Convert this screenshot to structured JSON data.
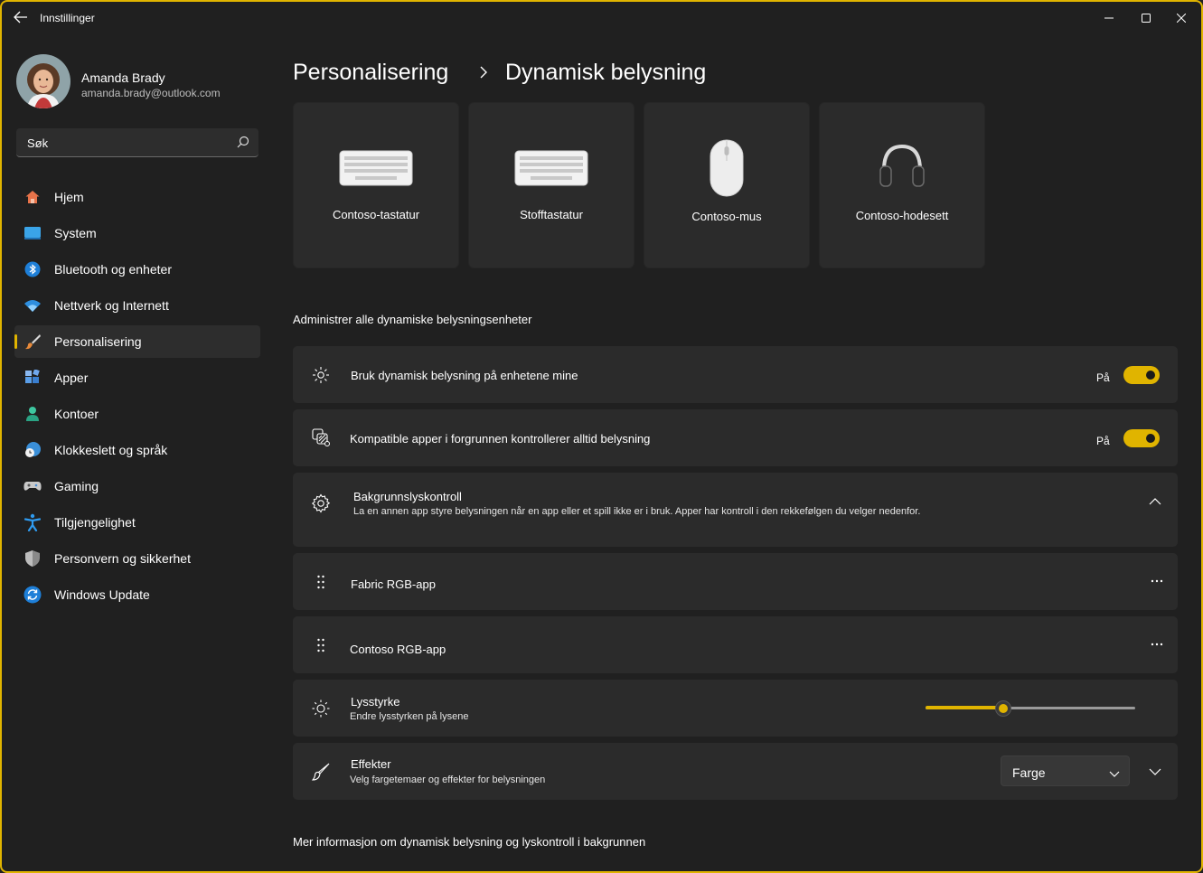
{
  "window": {
    "title": "Innstillinger"
  },
  "profile": {
    "name": "Amanda Brady",
    "email": "amanda.brady@outlook.com"
  },
  "search": {
    "placeholder": "Søk"
  },
  "nav": {
    "items": [
      {
        "label": "Hjem",
        "icon": "home-icon"
      },
      {
        "label": "System",
        "icon": "system-icon"
      },
      {
        "label": "Bluetooth og enheter",
        "icon": "bluetooth-icon"
      },
      {
        "label": "Nettverk og Internett",
        "icon": "wifi-icon"
      },
      {
        "label": "Personalisering",
        "icon": "brush-icon",
        "active": true
      },
      {
        "label": "Apper",
        "icon": "apps-icon"
      },
      {
        "label": "Kontoer",
        "icon": "account-icon"
      },
      {
        "label": "Klokkeslett og språk",
        "icon": "clock-globe-icon"
      },
      {
        "label": "Gaming",
        "icon": "gamepad-icon"
      },
      {
        "label": "Tilgjengelighet",
        "icon": "accessibility-icon"
      },
      {
        "label": "Personvern og sikkerhet",
        "icon": "shield-icon"
      },
      {
        "label": "Windows Update",
        "icon": "update-icon"
      }
    ]
  },
  "breadcrumb": {
    "parent": "Personalisering",
    "current": "Dynamisk belysning"
  },
  "devices": [
    {
      "label": "Contoso-tastatur",
      "icon": "keyboard-icon"
    },
    {
      "label": "Stofftastatur",
      "icon": "keyboard-icon"
    },
    {
      "label": "Contoso-mus",
      "icon": "mouse-icon"
    },
    {
      "label": "Contoso-hodesett",
      "icon": "headset-icon"
    }
  ],
  "manage_title": "Administrer alle dynamiske belysningsenheter",
  "settings": {
    "use_lighting": {
      "title": "Bruk dynamisk belysning på enhetene mine",
      "state": "På",
      "on": true
    },
    "compatible_apps": {
      "title": "Kompatible apper i forgrunnen kontrollerer alltid belysning",
      "state": "På",
      "on": true
    },
    "background_control": {
      "title": "Bakgrunnslyskontroll",
      "description": "La en annen app styre belysningen når en app eller et spill ikke er i bruk. Apper har kontroll i den rekkefølgen du velger nedenfor."
    },
    "apps": [
      {
        "label": "Fabric RGB-app"
      },
      {
        "label": "Contoso RGB-app"
      }
    ],
    "brightness": {
      "title": "Lysstyrke",
      "description": "Endre lysstyrken på lysene",
      "value": 37
    },
    "effects": {
      "title": "Effekter",
      "description": "Velg fargetemaer og effekter for belysningen",
      "selected": "Farge"
    }
  },
  "more_info": "Mer informasjon om dynamisk belysning og lyskontroll i bakgrunnen",
  "colors": {
    "accent": "#e0b400",
    "background": "#202020",
    "card": "#2b2b2b"
  }
}
